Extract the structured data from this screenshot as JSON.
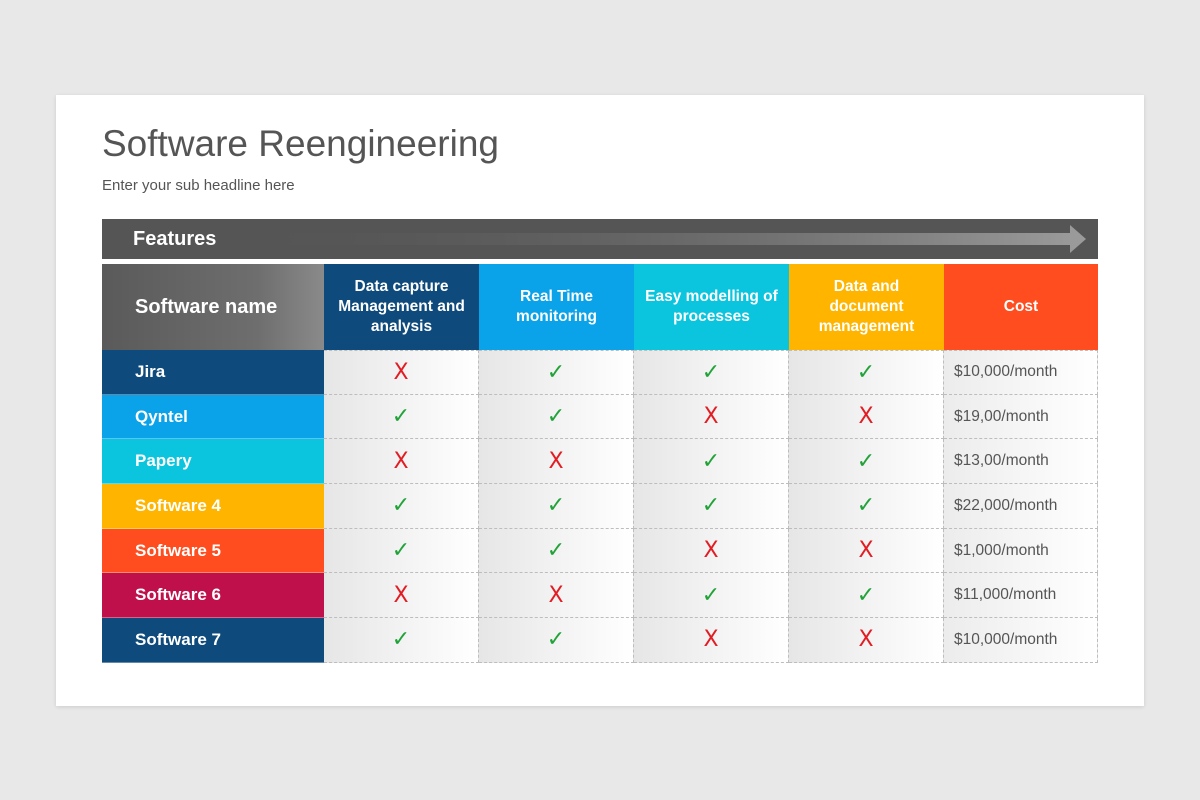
{
  "slide": {
    "title": "Software Reengineering",
    "subtitle": "Enter your sub headline here",
    "features_label": "Features",
    "features_bar_color": "#555555"
  },
  "table": {
    "name_header": "Software name",
    "columns": [
      {
        "label": "Data capture Management and analysis",
        "color": "#0e4a7b"
      },
      {
        "label": "Real Time monitoring",
        "color": "#0aa2e8"
      },
      {
        "label": "Easy modelling of processes",
        "color": "#0bc5df"
      },
      {
        "label": "Data and document management",
        "color": "#ffb400"
      }
    ],
    "cost_header": {
      "label": "Cost",
      "color": "#ff4d1f"
    },
    "yes_symbol": "✓",
    "no_symbol": "X",
    "rows": [
      {
        "name": "Jira",
        "color": "#0e4a7b",
        "features": [
          false,
          true,
          true,
          true
        ],
        "cost": "$10,000/month"
      },
      {
        "name": "Qyntel",
        "color": "#0aa2e8",
        "features": [
          true,
          true,
          false,
          false
        ],
        "cost": "$19,00/month"
      },
      {
        "name": "Papery",
        "color": "#0bc5df",
        "features": [
          false,
          false,
          true,
          true
        ],
        "cost": "$13,00/month"
      },
      {
        "name": "Software 4",
        "color": "#ffb400",
        "features": [
          true,
          true,
          true,
          true
        ],
        "cost": "$22,000/month"
      },
      {
        "name": "Software 5",
        "color": "#ff4d1f",
        "features": [
          true,
          true,
          false,
          false
        ],
        "cost": "$1,000/month"
      },
      {
        "name": "Software 6",
        "color": "#c0104c",
        "features": [
          false,
          false,
          true,
          true
        ],
        "cost": "$11,000/month"
      },
      {
        "name": "Software 7",
        "color": "#0e4a7b",
        "features": [
          true,
          true,
          false,
          false
        ],
        "cost": "$10,000/month"
      }
    ]
  }
}
